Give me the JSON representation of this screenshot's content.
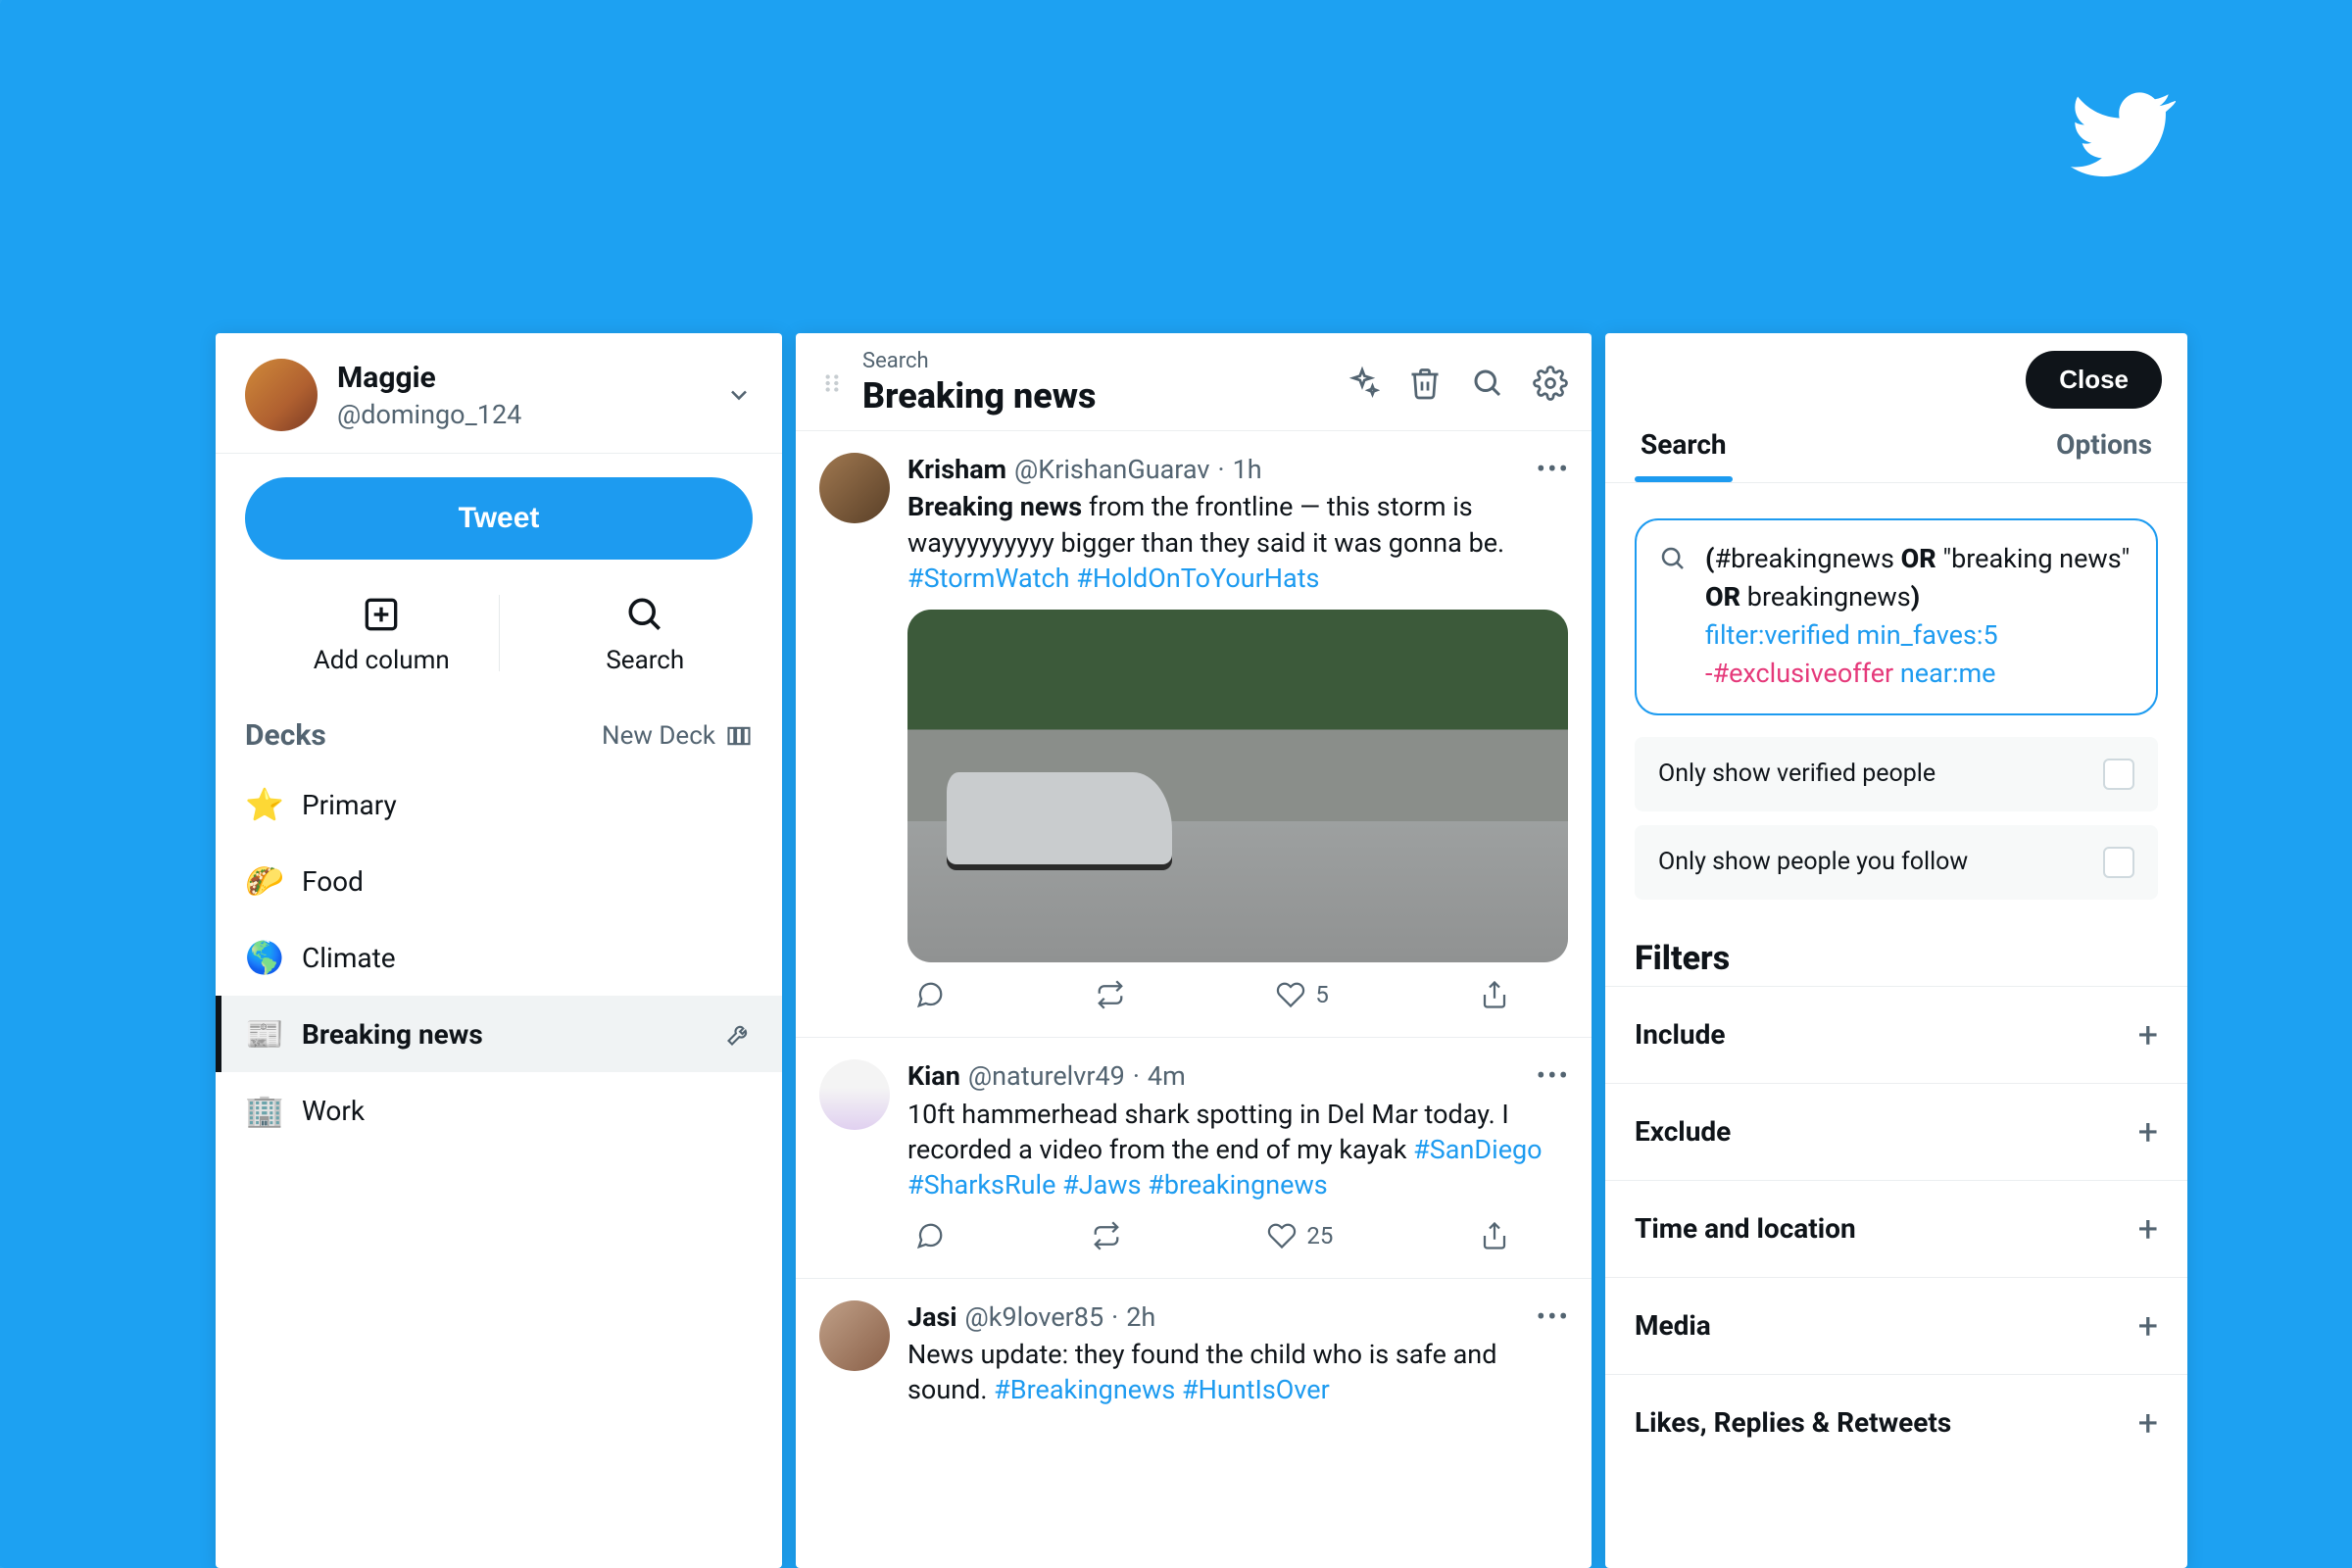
{
  "brand": {
    "icon": "twitter-bird"
  },
  "profile": {
    "name": "Maggie",
    "handle": "@domingo_124"
  },
  "compose": {
    "tweet_label": "Tweet"
  },
  "quick_actions": {
    "add_column_label": "Add column",
    "search_label": "Search"
  },
  "decks": {
    "title": "Decks",
    "new_deck_label": "New Deck",
    "items": [
      {
        "icon": "⭐",
        "label": "Primary",
        "active": false
      },
      {
        "icon": "🌮",
        "label": "Food",
        "active": false
      },
      {
        "icon": "🌎",
        "label": "Climate",
        "active": false
      },
      {
        "icon": "📰",
        "label": "Breaking news",
        "active": true
      },
      {
        "icon": "🏢",
        "label": "Work",
        "active": false
      }
    ]
  },
  "feed": {
    "super_title": "Search",
    "title": "Breaking news",
    "toolbar_icons": [
      "sparkle-icon",
      "trash-icon",
      "search-icon",
      "gear-icon"
    ],
    "tweets": [
      {
        "name": "Krisham",
        "handle": "@KrishanGuarav",
        "time": "1h",
        "lead_bold": "Breaking news",
        "text_rest": " from the frontline — this storm is wayyyyyyyyy bigger than they said it was gonna be. ",
        "hashtags": [
          "#StormWatch",
          "#HoldOnToYourHats"
        ],
        "has_media": true,
        "like_count": "5"
      },
      {
        "name": "Kian",
        "handle": "@naturelvr49",
        "time": "4m",
        "lead_bold": "",
        "text_rest": "10ft hammerhead shark spotting in Del Mar today. I recorded a video from the end of my kayak ",
        "hashtags": [
          "#SanDiego",
          "#SharksRule",
          "#Jaws",
          "#breakingnews"
        ],
        "has_media": false,
        "like_count": "25"
      },
      {
        "name": "Jasi",
        "handle": "@k9lover85",
        "time": "2h",
        "lead_bold": "",
        "text_rest": "News update: they found the child who is safe and sound. ",
        "hashtags": [
          "#Breakingnews",
          "#HuntIsOver"
        ],
        "has_media": false,
        "like_count": ""
      }
    ]
  },
  "right": {
    "close_label": "Close",
    "tabs": {
      "search": "Search",
      "options": "Options",
      "active": "search"
    },
    "query": {
      "line1_prefix": "(",
      "line1_term1": "#breakingnews",
      "op_or": "OR",
      "line1_term2": "\"breaking news\"",
      "line1_term3": "breakingnews",
      "line1_suffix": ")",
      "filter_verified": "filter:verified",
      "min_faves": "min_faves:5",
      "exclude": "-#exclusiveoffer",
      "near_me": "near:me"
    },
    "toggles": {
      "verified_label": "Only show verified people",
      "following_label": "Only show people you follow"
    },
    "filters_title": "Filters",
    "filter_sections": [
      "Include",
      "Exclude",
      "Time and location",
      "Media",
      "Likes, Replies & Retweets"
    ]
  }
}
